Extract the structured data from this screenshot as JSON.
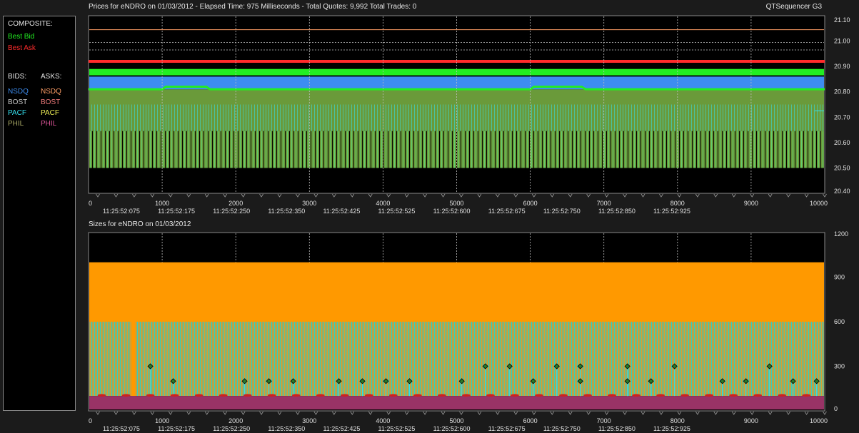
{
  "header": {
    "prices_title": "Prices for  eNDRO  on  01/03/2012   -  Elapsed Time: 975 Milliseconds  -  Total Quotes: 9,992  Total Trades: 0",
    "app_name": "QTSequencer G3",
    "sizes_title": "Sizes for  eNDRO  on  01/03/2012"
  },
  "legend": {
    "composite_label": "COMPOSITE:",
    "best_bid": "Best Bid",
    "best_ask": "Best Ask",
    "bids_label": "BIDS:",
    "asks_label": "ASKS:",
    "bids": [
      "NSDQ",
      "BOST",
      "PACF",
      "PHIL"
    ],
    "asks": [
      "NSDQ",
      "BOST",
      "PACF",
      "PHIL"
    ]
  },
  "colors": {
    "best_bid": "#22ee22",
    "best_ask": "#ff2b2b",
    "nsdq_bid": "#3d8df0",
    "nsdq_ask": "#ff9e66",
    "bost_bid": "#c8c8c8",
    "bost_ask": "#f07a7a",
    "pacf_bid": "#33e0ee",
    "pacf_ask": "#f0f055",
    "phil_bid": "#aaaa66",
    "phil_ask": "#dd5599",
    "price_fill_green": "#6a9a3a",
    "price_fill_light": "#5fcf70",
    "size_orange": "#ff9900",
    "size_purple": "#993366",
    "size_stripe": "#aaa655"
  },
  "chart_data": [
    {
      "type": "area",
      "title": "Prices for  eNDRO  on  01/03/2012",
      "x_ticks": [
        0,
        1000,
        2000,
        3000,
        4000,
        5000,
        6000,
        7000,
        8000,
        9000,
        10000
      ],
      "x_time_labels": [
        "11:25:52:075",
        "11:25:52:175",
        "11:25:52:250",
        "11:25:52:350",
        "11:25:52:425",
        "11:25:52:525",
        "11:25:52:600",
        "11:25:52:675",
        "11:25:52:750",
        "11:25:52:850",
        "11:25:52:925"
      ],
      "y_ticks": [
        "21.10",
        "21.00",
        "20.90",
        "20.80",
        "20.70",
        "20.60",
        "20.50",
        "20.40"
      ],
      "xlim": [
        0,
        10000
      ],
      "ylim": [
        20.4,
        21.1
      ],
      "series": [
        {
          "name": "Best Ask",
          "x": [
            0,
            10000
          ],
          "values": [
            20.92,
            20.92
          ]
        },
        {
          "name": "Best Bid",
          "x": [
            0,
            1000,
            1050,
            1600,
            1650,
            6000,
            6050,
            6700,
            6750,
            10000
          ],
          "values": [
            20.81,
            20.81,
            20.82,
            20.82,
            20.81,
            20.81,
            20.82,
            20.82,
            20.81,
            20.81
          ]
        }
      ],
      "grid": true
    },
    {
      "type": "area",
      "title": "Sizes for  eNDRO  on  01/03/2012",
      "x_ticks": [
        0,
        1000,
        2000,
        3000,
        4000,
        5000,
        6000,
        7000,
        8000,
        9000,
        10000
      ],
      "x_time_labels": [
        "11:25:52:075",
        "11:25:52:175",
        "11:25:52:250",
        "11:25:52:350",
        "11:25:52:425",
        "11:25:52:525",
        "11:25:52:600",
        "11:25:52:675",
        "11:25:52:750",
        "11:25:52:850",
        "11:25:52:925"
      ],
      "y_ticks": [
        "1200",
        "900",
        "600",
        "300",
        "0"
      ],
      "xlim": [
        0,
        10000
      ],
      "ylim": [
        0,
        1200
      ],
      "series": [
        {
          "name": "PHIL",
          "values": [
            100,
            100
          ]
        },
        {
          "name": "NSDQ",
          "values": [
            1000,
            1000
          ]
        }
      ],
      "grid": true
    }
  ]
}
